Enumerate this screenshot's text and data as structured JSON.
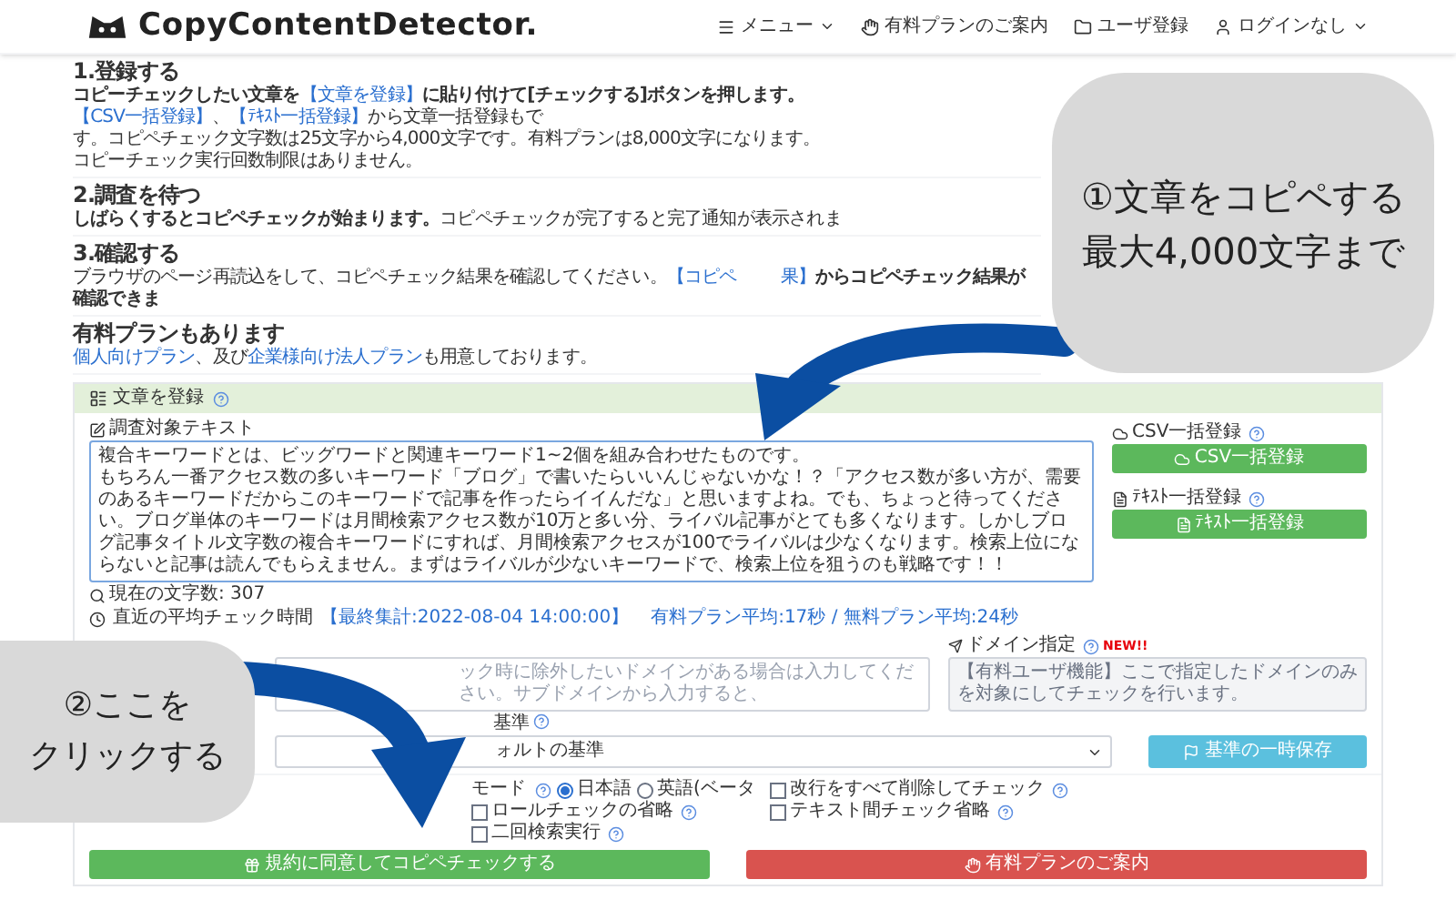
{
  "header": {
    "logo": "CopyContentDetector.",
    "nav": [
      {
        "label": "メニュー"
      },
      {
        "label": "有料プランのご案内"
      },
      {
        "label": "ユーザ登録"
      },
      {
        "label": "ログインなし"
      }
    ]
  },
  "steps": [
    {
      "title": "1.登録する",
      "paragraphs": [
        [
          {
            "kind": "bold",
            "text": "コピーチェックしたい文章を"
          },
          {
            "kind": "link",
            "text": "【文章を登録】"
          },
          {
            "kind": "bold",
            "text": "に貼り付けて[チェックする]ボタンを押します。"
          },
          {
            "kind": "link",
            "text": "【CSV一括登録】"
          },
          {
            "kind": "plain",
            "text": "、"
          },
          {
            "kind": "link",
            "text": "【ﾃｷｽﾄ一括登録】"
          },
          {
            "kind": "plain",
            "text": "から文章一括登録もで"
          }
        ],
        [
          {
            "kind": "plain",
            "text": "す。コピペチェック文字数は25文字から4,000文字です。有料プランは8,000文字になります。"
          }
        ],
        [
          {
            "kind": "plain",
            "text": "コピーチェック実行回数制限はありません。"
          }
        ]
      ]
    },
    {
      "title": "2.調査を待つ",
      "paragraphs": [
        [
          {
            "kind": "bold",
            "text": "しばらくするとコピペチェックが始まります。"
          },
          {
            "kind": "plain",
            "text": "コピペチェックが完了すると完了通知が表示されま"
          }
        ]
      ]
    },
    {
      "title": "3.確認する",
      "paragraphs": [
        [
          {
            "kind": "plain",
            "text": "ブラウザのページ再読込をして、コピペチェック結果を確認してください。"
          },
          {
            "kind": "link",
            "text": "【コピペ"
          },
          {
            "kind": "link",
            "text": "果】"
          },
          {
            "kind": "bold",
            "text": "からコピペチェック結果が確認できま"
          }
        ]
      ]
    },
    {
      "title": "有料プランもあります",
      "paragraphs": [
        [
          {
            "kind": "link",
            "text": "個人向けプラン"
          },
          {
            "kind": "plain",
            "text": "、及び"
          },
          {
            "kind": "link",
            "text": "企業様向け法人プラン"
          },
          {
            "kind": "plain",
            "text": "も用意しております。"
          }
        ]
      ]
    }
  ],
  "form": {
    "title": "文章を登録",
    "text_label": "調査対象テキスト",
    "text_lines": [
      "複合キーワードとは、ビッグワードと関連キーワード1~2個を組み合わせたものです。",
      "もちろん一番アクセス数の多いキーワード「ブログ」で書いたらいいんじゃないかな！？「アクセス数が多い方が、需要のあるキーワードだからこのキーワードで記事を作ったらイイんだな」と思いますよね。でも、ちょっと待ってください。ブログ単体のキーワードは月間検索アクセス数が10万と多い分、ライバル記事がとても多くなります。しかしブログ記事タイトル文字数の複合キーワードにすれば、月間検索アクセスが100でライバルは少なくなります。検索上位にならないと記事は読んでもらえません。まずはライバルが少ないキーワードで、検索上位を狙うのも戦略です！！"
    ],
    "char_count": "現在の文字数: 307",
    "avg_time_label": "直近の平均チェック時間",
    "avg_time_date": "【最終集計:2022-08-04 14:00:00】",
    "avg_time_values": "有料プラン平均:17秒 / 無料プラン平均:24秒",
    "uploads": [
      {
        "label": "CSV一括登録",
        "button": "CSV一括登録"
      },
      {
        "label": "ﾃｷｽﾄ一括登録",
        "button": "ﾃｷｽﾄ一括登録"
      }
    ],
    "exclude_placeholder": "ック時に除外したいドメインがある場合は入力してください。サブドメインから入力すると、",
    "domain_label": "ドメイン指定",
    "domain_badge": "NEW!!",
    "domain_placeholder": "【有料ユーザ機能】ここで指定したドメインのみを対象にしてチェックを行います。",
    "standard_label": "基準",
    "standard_value": "ォルトの基準",
    "save_button": "基準の一時保存",
    "options_left": [
      {
        "kind": "radio_group",
        "label": "モード",
        "options": [
          {
            "label": "日本語",
            "selected": true
          },
          {
            "label": "英語(ベータ",
            "selected": false
          }
        ]
      },
      {
        "kind": "checkbox",
        "label": "ロールチェックの省略",
        "checked": false
      },
      {
        "kind": "checkbox",
        "label": "二回検索実行",
        "checked": false
      }
    ],
    "options_right": [
      {
        "kind": "checkbox",
        "label": "改行をすべて削除してチェック",
        "checked": false
      },
      {
        "kind": "checkbox",
        "label": "テキスト間チェック省略",
        "checked": false
      }
    ],
    "check_button": "規約に同意してコピペチェックする",
    "plan_button": "有料プランのご案内"
  },
  "annotations": [
    {
      "lines": [
        "①文章をコピペする",
        "最大4,000文字まで"
      ]
    },
    {
      "lines": [
        "②ここを",
        "クリックする"
      ]
    }
  ]
}
